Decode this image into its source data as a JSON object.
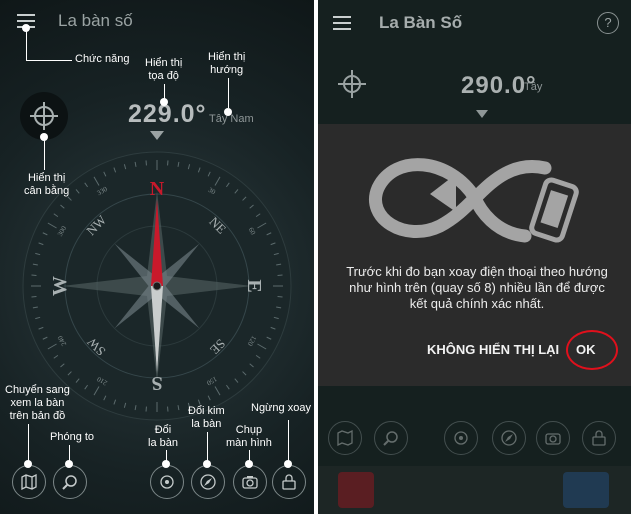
{
  "left": {
    "app_title": "La bàn số",
    "heading_value": "229.0°",
    "heading_direction": "Tây Nam",
    "annotations": {
      "menu": "Chức năng",
      "coords": "Hiển thị\ntọa độ",
      "direction": "Hiển thị\nhướng",
      "level": "Hiển thị\ncân bằng",
      "map": "Chuyển sang\nxem la bàn\ntrên bản đồ",
      "zoom": "Phóng to",
      "switch_compass": "Đổi\nla bàn",
      "switch_needle": "Đổi kim\nla bàn",
      "screenshot": "Chụp\nmàn hình",
      "stop_rotate": "Ngừng xoay"
    },
    "compass": {
      "cardinals": [
        "N",
        "E",
        "S",
        "W"
      ],
      "intercardinals": [
        "NE",
        "SE",
        "SW",
        "NW"
      ],
      "degree_labels": [
        "0",
        "30",
        "60",
        "90",
        "120",
        "150",
        "180",
        "210",
        "240",
        "270",
        "300",
        "330"
      ],
      "needle_colors": {
        "north": "#c8192b",
        "south": "#c9cdcd"
      }
    }
  },
  "right": {
    "app_title": "La Bàn Số",
    "heading_value": "290.0°",
    "heading_direction": "Tây",
    "help_label": "?",
    "dialog": {
      "message": "Trước khi đo bạn xoay điện thoại theo hướng như hình trên (quay số 8) nhiều lần để được kết quả chính xác nhất.",
      "dont_show_label": "KHÔNG HIỂN THỊ LẠI",
      "ok_label": "OK",
      "highlight_color": "#e0101c"
    }
  },
  "icons": [
    "menu-icon",
    "crosshair-icon",
    "map-icon",
    "zoom-icon",
    "compass-switch-icon",
    "needle-icon",
    "camera-icon",
    "lock-icon",
    "help-icon",
    "infinity-phone-icon"
  ]
}
